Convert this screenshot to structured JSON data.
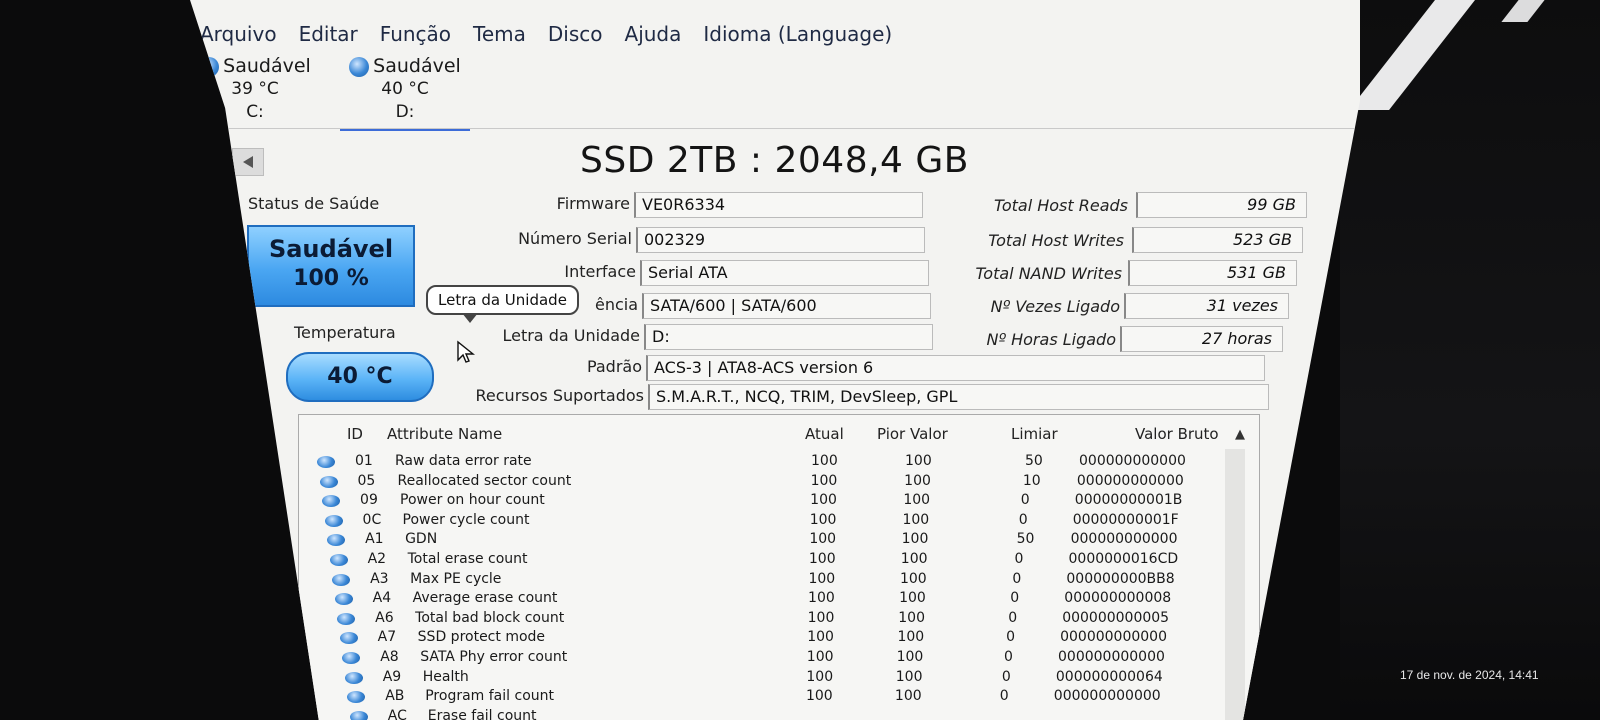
{
  "menu": [
    "Arquivo",
    "Editar",
    "Função",
    "Tema",
    "Disco",
    "Ajuda",
    "Idioma (Language)"
  ],
  "drives": [
    {
      "status": "Saudável",
      "temp": "39 °C",
      "letter": "C:",
      "active": false
    },
    {
      "status": "Saudável",
      "temp": "40 °C",
      "letter": "D:",
      "active": true
    }
  ],
  "title": "SSD 2TB : 2048,4 GB",
  "health": {
    "label": "Status de Saúde",
    "status": "Saudável",
    "percent": "100 %"
  },
  "temperature": {
    "label": "Temperatura",
    "value": "40 °C"
  },
  "fields": {
    "firmware": {
      "label": "Firmware",
      "value": "VE0R6334"
    },
    "serial": {
      "label": "Número Serial",
      "value": "002329"
    },
    "interface": {
      "label": "Interface",
      "value": "Serial ATA"
    },
    "transfer": {
      "label": "ência",
      "value": "SATA/600 | SATA/600"
    },
    "drive_letter": {
      "label": "Letra da Unidade",
      "value": "D:"
    },
    "standard": {
      "label": "Padrão",
      "value": "ACS-3 | ATA8-ACS version 6"
    },
    "features": {
      "label": "Recursos Suportados",
      "value": "S.M.A.R.T., NCQ, TRIM, DevSleep, GPL"
    }
  },
  "right_fields": {
    "host_reads": {
      "label": "Total Host Reads",
      "value": "99 GB"
    },
    "host_writes": {
      "label": "Total Host Writes",
      "value": "523 GB"
    },
    "nand_writes": {
      "label": "Total NAND Writes",
      "value": "531 GB"
    },
    "power_on_count": {
      "label": "Nº Vezes Ligado",
      "value": "31 vezes"
    },
    "power_on_hours": {
      "label": "Nº Horas Ligado",
      "value": "27 horas"
    }
  },
  "tooltip": "Letra da Unidade",
  "smart": {
    "headers": {
      "id": "ID",
      "name": "Attribute Name",
      "current": "Atual",
      "worst": "Pior Valor",
      "threshold": "Limiar",
      "raw": "Valor Bruto"
    },
    "rows": [
      {
        "id": "01",
        "name": "Raw data error rate",
        "current": "100",
        "worst": "100",
        "threshold": "50",
        "raw": "000000000000"
      },
      {
        "id": "05",
        "name": "Reallocated sector count",
        "current": "100",
        "worst": "100",
        "threshold": "10",
        "raw": "000000000000"
      },
      {
        "id": "09",
        "name": "Power on hour count",
        "current": "100",
        "worst": "100",
        "threshold": "0",
        "raw": "00000000001B"
      },
      {
        "id": "0C",
        "name": "Power cycle count",
        "current": "100",
        "worst": "100",
        "threshold": "0",
        "raw": "00000000001F"
      },
      {
        "id": "A1",
        "name": "GDN",
        "current": "100",
        "worst": "100",
        "threshold": "50",
        "raw": "000000000000"
      },
      {
        "id": "A2",
        "name": "Total erase count",
        "current": "100",
        "worst": "100",
        "threshold": "0",
        "raw": "0000000016CD"
      },
      {
        "id": "A3",
        "name": "Max PE cycle",
        "current": "100",
        "worst": "100",
        "threshold": "0",
        "raw": "000000000BB8"
      },
      {
        "id": "A4",
        "name": "Average erase count",
        "current": "100",
        "worst": "100",
        "threshold": "0",
        "raw": "000000000008"
      },
      {
        "id": "A6",
        "name": "Total bad block count",
        "current": "100",
        "worst": "100",
        "threshold": "0",
        "raw": "000000000005"
      },
      {
        "id": "A7",
        "name": "SSD protect mode",
        "current": "100",
        "worst": "100",
        "threshold": "0",
        "raw": "000000000000"
      },
      {
        "id": "A8",
        "name": "SATA Phy error count",
        "current": "100",
        "worst": "100",
        "threshold": "0",
        "raw": "000000000000"
      },
      {
        "id": "A9",
        "name": "Health",
        "current": "100",
        "worst": "100",
        "threshold": "0",
        "raw": "000000000064"
      },
      {
        "id": "AB",
        "name": "Program fail count",
        "current": "100",
        "worst": "100",
        "threshold": "0",
        "raw": "000000000000"
      },
      {
        "id": "AC",
        "name": "Erase fail count",
        "current": "",
        "worst": "",
        "threshold": "",
        "raw": ""
      }
    ]
  },
  "overlay_timestamp": "17 de nov. de 2024, 14:41"
}
